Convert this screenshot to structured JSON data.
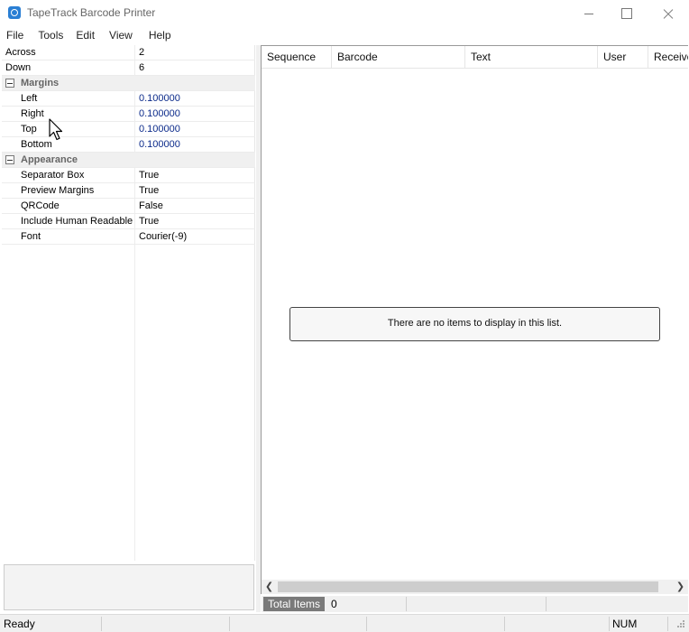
{
  "window": {
    "title": "TapeTrack Barcode Printer"
  },
  "menu": [
    "File",
    "Tools",
    "Edit",
    "View",
    "Help"
  ],
  "property_grid": {
    "rows": [
      {
        "type": "prop",
        "name": "Across",
        "value": "2",
        "indent": false
      },
      {
        "type": "prop",
        "name": "Down",
        "value": "6",
        "indent": false
      },
      {
        "type": "category",
        "name": "Margins"
      },
      {
        "type": "prop",
        "name": "Left",
        "value": "0.100000",
        "indent": true,
        "blue": true
      },
      {
        "type": "prop",
        "name": "Right",
        "value": "0.100000",
        "indent": true,
        "blue": true
      },
      {
        "type": "prop",
        "name": "Top",
        "value": "0.100000",
        "indent": true,
        "blue": true
      },
      {
        "type": "prop",
        "name": "Bottom",
        "value": "0.100000",
        "indent": true,
        "blue": true
      },
      {
        "type": "category",
        "name": "Appearance"
      },
      {
        "type": "prop",
        "name": "Separator Box",
        "value": "True",
        "indent": true
      },
      {
        "type": "prop",
        "name": "Preview Margins",
        "value": "True",
        "indent": true
      },
      {
        "type": "prop",
        "name": "QRCode",
        "value": "False",
        "indent": true
      },
      {
        "type": "prop",
        "name": "Include Human Readable",
        "value": "True",
        "indent": true
      },
      {
        "type": "prop",
        "name": "Font",
        "value": "Courier(-9)",
        "indent": true
      }
    ]
  },
  "list": {
    "columns": [
      "Sequence",
      "Barcode",
      "Text",
      "User",
      "Received"
    ],
    "empty_message": "There are no items to display in this list."
  },
  "footer": {
    "total_label": "Total Items",
    "total_value": "0"
  },
  "status": {
    "text": "Ready",
    "num": "NUM"
  },
  "icons": {
    "app": "app-logo-icon",
    "scroll_left": "chevron-left-icon",
    "scroll_right": "chevron-right-icon",
    "collapse": "collapse-minus-icon",
    "cursor": "mouse-pointer-icon"
  }
}
